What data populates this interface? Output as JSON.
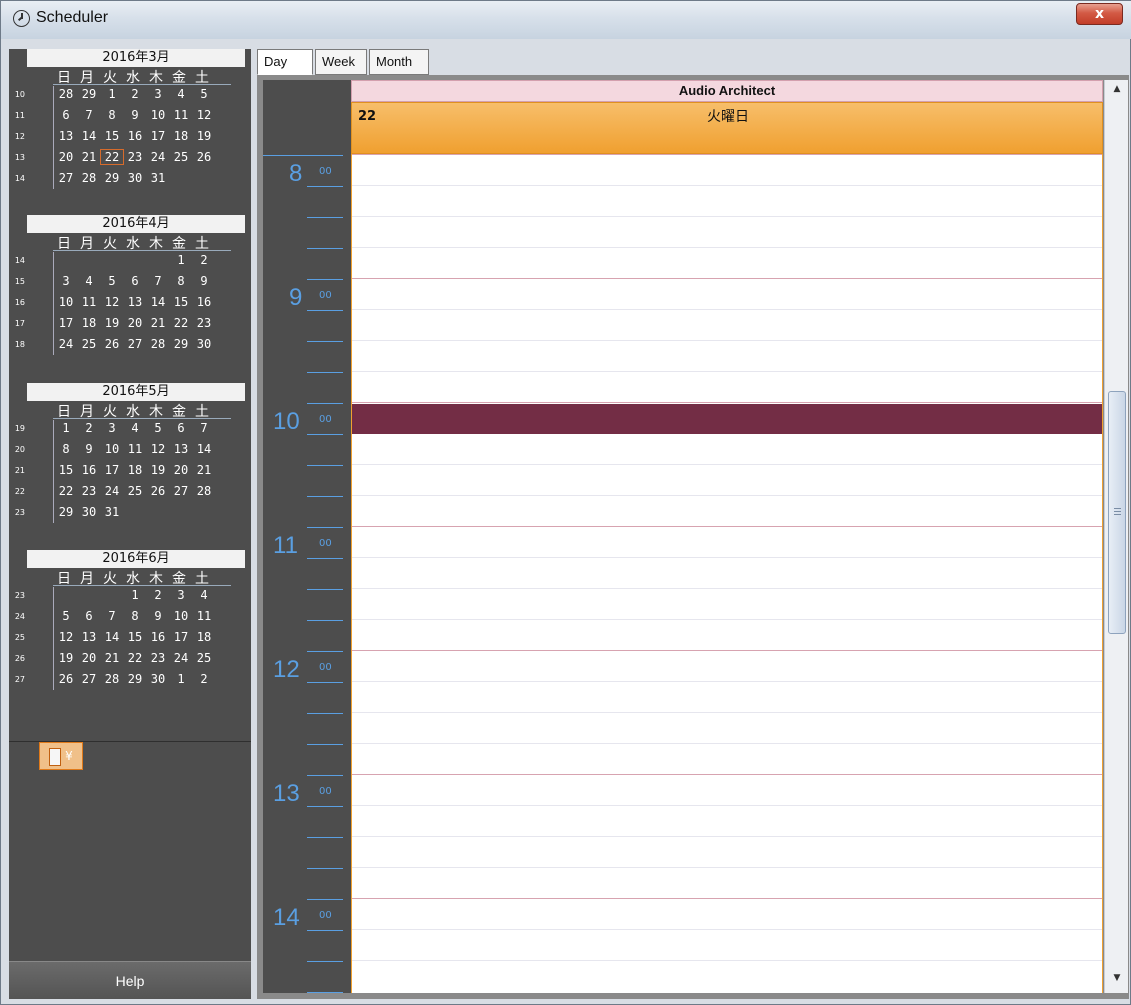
{
  "window": {
    "title": "Scheduler",
    "close_label": "x"
  },
  "navigation": {
    "prev_year": "«",
    "prev_month": "◂",
    "next_month": "▸",
    "next_year": "»"
  },
  "mini_calendars": [
    {
      "header": "2016年3月",
      "dow": [
        "日",
        "月",
        "火",
        "水",
        "木",
        "金",
        "土"
      ],
      "weeks": [
        {
          "num": "10",
          "days": [
            "28",
            "29",
            "1",
            "2",
            "3",
            "4",
            "5"
          ]
        },
        {
          "num": "11",
          "days": [
            "6",
            "7",
            "8",
            "9",
            "10",
            "11",
            "12"
          ]
        },
        {
          "num": "12",
          "days": [
            "13",
            "14",
            "15",
            "16",
            "17",
            "18",
            "19"
          ]
        },
        {
          "num": "13",
          "days": [
            "20",
            "21",
            "22",
            "23",
            "24",
            "25",
            "26"
          ]
        },
        {
          "num": "14",
          "days": [
            "27",
            "28",
            "29",
            "30",
            "31",
            "",
            ""
          ]
        }
      ],
      "today": "22"
    },
    {
      "header": "2016年4月",
      "dow": [
        "日",
        "月",
        "火",
        "水",
        "木",
        "金",
        "土"
      ],
      "weeks": [
        {
          "num": "14",
          "days": [
            "",
            "",
            "",
            "",
            "",
            "1",
            "2"
          ]
        },
        {
          "num": "15",
          "days": [
            "3",
            "4",
            "5",
            "6",
            "7",
            "8",
            "9"
          ]
        },
        {
          "num": "16",
          "days": [
            "10",
            "11",
            "12",
            "13",
            "14",
            "15",
            "16"
          ]
        },
        {
          "num": "17",
          "days": [
            "17",
            "18",
            "19",
            "20",
            "21",
            "22",
            "23"
          ]
        },
        {
          "num": "18",
          "days": [
            "24",
            "25",
            "26",
            "27",
            "28",
            "29",
            "30"
          ]
        }
      ]
    },
    {
      "header": "2016年5月",
      "dow": [
        "日",
        "月",
        "火",
        "水",
        "木",
        "金",
        "土"
      ],
      "weeks": [
        {
          "num": "19",
          "days": [
            "1",
            "2",
            "3",
            "4",
            "5",
            "6",
            "7"
          ]
        },
        {
          "num": "20",
          "days": [
            "8",
            "9",
            "10",
            "11",
            "12",
            "13",
            "14"
          ]
        },
        {
          "num": "21",
          "days": [
            "15",
            "16",
            "17",
            "18",
            "19",
            "20",
            "21"
          ]
        },
        {
          "num": "22",
          "days": [
            "22",
            "23",
            "24",
            "25",
            "26",
            "27",
            "28"
          ]
        },
        {
          "num": "23",
          "days": [
            "29",
            "30",
            "31",
            "",
            "",
            "",
            ""
          ]
        }
      ]
    },
    {
      "header": "2016年6月",
      "dow": [
        "日",
        "月",
        "火",
        "水",
        "木",
        "金",
        "土"
      ],
      "weeks": [
        {
          "num": "23",
          "days": [
            "",
            "",
            "",
            "1",
            "2",
            "3",
            "4"
          ]
        },
        {
          "num": "24",
          "days": [
            "5",
            "6",
            "7",
            "8",
            "9",
            "10",
            "11"
          ]
        },
        {
          "num": "25",
          "days": [
            "12",
            "13",
            "14",
            "15",
            "16",
            "17",
            "18"
          ]
        },
        {
          "num": "26",
          "days": [
            "19",
            "20",
            "21",
            "22",
            "23",
            "24",
            "25"
          ]
        },
        {
          "num": "27",
          "days": [
            "26",
            "27",
            "28",
            "29",
            "30",
            "1",
            "2"
          ]
        }
      ]
    }
  ],
  "toolbar": {
    "yen_button_label": "¥"
  },
  "help_label": "Help",
  "tabs": [
    "Day",
    "Week",
    "Month"
  ],
  "active_tab": "Day",
  "resource": "Audio Architect",
  "day": {
    "number": "22",
    "weekday": "火曜日"
  },
  "hours": [
    "8",
    "9",
    "10",
    "11",
    "12",
    "13",
    "14"
  ],
  "minute_label": "00",
  "colors": {
    "accent_orange": "#f0a030",
    "event_band": "#732d45",
    "hour_label": "#5a9fe2",
    "panel_bg": "#4d4d4d"
  }
}
